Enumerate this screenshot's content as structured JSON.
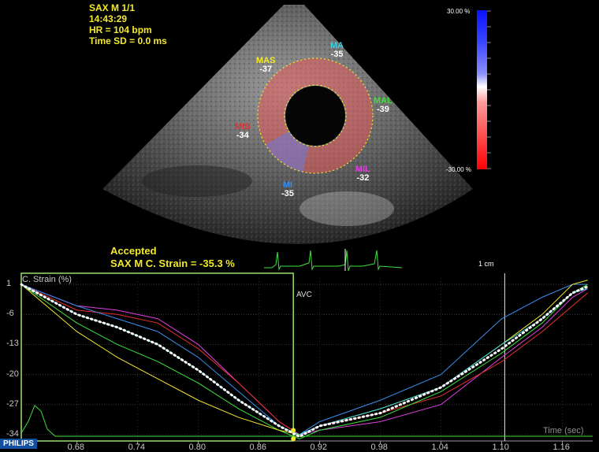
{
  "header": {
    "view": "SAX M  1/1",
    "time": "14:43:29",
    "hr": "HR = 104 bpm",
    "timesd": "Time SD = 0.0 ms"
  },
  "segments": [
    {
      "key": "MA",
      "label": "MA",
      "value": "-35",
      "color": "#3ad0e0"
    },
    {
      "key": "MAS",
      "label": "MAS",
      "value": "-37",
      "color": "#f2e92b"
    },
    {
      "key": "MAL",
      "label": "MAL",
      "value": "-39",
      "color": "#3ee03e"
    },
    {
      "key": "MIS",
      "label": "MIS",
      "value": "-34",
      "color": "#e83030"
    },
    {
      "key": "MIL",
      "label": "MIL",
      "value": "-32",
      "color": "#e040e0"
    },
    {
      "key": "MI",
      "label": "MI",
      "value": "-35",
      "color": "#3a8ef0"
    }
  ],
  "colorscale": {
    "top": "30.00 %",
    "bottom": "-30.00 %"
  },
  "status": {
    "accepted": "Accepted",
    "result": "SAX M C. Strain = -35.3 %"
  },
  "scale_mark": "1 cm",
  "chart_data": {
    "type": "line",
    "ylabel": "C. Strain (%)",
    "xlabel": "Time (sec)",
    "marker": "AVC",
    "yticks": [
      1,
      -6,
      -13,
      -20,
      -27,
      -34
    ],
    "xticks": [
      "0.68",
      "0.74",
      "0.80",
      "0.86",
      "0.92",
      "0.98",
      "1.04",
      "1.10",
      "1.16"
    ],
    "xlim": [
      0.625,
      1.19
    ],
    "ylim": [
      -35.5,
      2.5
    ],
    "avc_x": 0.894,
    "series": [
      {
        "color": "#e040e0",
        "points": [
          [
            0.625,
            1
          ],
          [
            0.68,
            -4
          ],
          [
            0.72,
            -5
          ],
          [
            0.76,
            -7
          ],
          [
            0.8,
            -13
          ],
          [
            0.84,
            -22
          ],
          [
            0.88,
            -31
          ],
          [
            0.9,
            -34
          ],
          [
            0.92,
            -33
          ],
          [
            0.98,
            -31
          ],
          [
            1.04,
            -27
          ],
          [
            1.1,
            -16
          ],
          [
            1.14,
            -9
          ],
          [
            1.17,
            -2
          ],
          [
            1.185,
            0
          ]
        ]
      },
      {
        "color": "#e83030",
        "points": [
          [
            0.625,
            1
          ],
          [
            0.68,
            -5
          ],
          [
            0.72,
            -6
          ],
          [
            0.76,
            -8
          ],
          [
            0.8,
            -14
          ],
          [
            0.84,
            -22
          ],
          [
            0.88,
            -31
          ],
          [
            0.9,
            -34
          ],
          [
            0.92,
            -32
          ],
          [
            0.98,
            -29
          ],
          [
            1.04,
            -25
          ],
          [
            1.1,
            -17
          ],
          [
            1.14,
            -10
          ],
          [
            1.17,
            -4
          ],
          [
            1.185,
            -1
          ]
        ]
      },
      {
        "color": "#3a8ef0",
        "points": [
          [
            0.625,
            1
          ],
          [
            0.68,
            -4
          ],
          [
            0.72,
            -7
          ],
          [
            0.76,
            -10
          ],
          [
            0.8,
            -16
          ],
          [
            0.84,
            -24
          ],
          [
            0.88,
            -32
          ],
          [
            0.9,
            -34
          ],
          [
            0.92,
            -31
          ],
          [
            0.98,
            -26
          ],
          [
            1.04,
            -20
          ],
          [
            1.1,
            -7
          ],
          [
            1.14,
            -2
          ],
          [
            1.17,
            1
          ],
          [
            1.185,
            1
          ]
        ]
      },
      {
        "color": "#3ee03e",
        "points": [
          [
            0.625,
            1
          ],
          [
            0.68,
            -8
          ],
          [
            0.72,
            -13
          ],
          [
            0.76,
            -17
          ],
          [
            0.8,
            -22
          ],
          [
            0.84,
            -28
          ],
          [
            0.88,
            -33
          ],
          [
            0.9,
            -35
          ],
          [
            0.92,
            -33
          ],
          [
            0.98,
            -30
          ],
          [
            1.04,
            -24
          ],
          [
            1.1,
            -15
          ],
          [
            1.14,
            -8
          ],
          [
            1.17,
            -1
          ],
          [
            1.185,
            1
          ]
        ]
      },
      {
        "color": "#f2e92b",
        "points": [
          [
            0.625,
            1
          ],
          [
            0.68,
            -10
          ],
          [
            0.72,
            -16
          ],
          [
            0.76,
            -21
          ],
          [
            0.8,
            -26
          ],
          [
            0.84,
            -30
          ],
          [
            0.88,
            -33
          ],
          [
            0.9,
            -34
          ],
          [
            0.92,
            -32
          ],
          [
            0.98,
            -28
          ],
          [
            1.04,
            -23
          ],
          [
            1.1,
            -13
          ],
          [
            1.14,
            -6
          ],
          [
            1.17,
            1
          ],
          [
            1.185,
            2
          ]
        ]
      },
      {
        "color": "#3ad0e0",
        "points": [
          [
            0.625,
            1
          ],
          [
            0.68,
            -6
          ],
          [
            0.72,
            -9
          ],
          [
            0.76,
            -13
          ],
          [
            0.8,
            -19
          ],
          [
            0.84,
            -26
          ],
          [
            0.88,
            -32
          ],
          [
            0.9,
            -34
          ],
          [
            0.92,
            -32
          ],
          [
            0.98,
            -28
          ],
          [
            1.04,
            -23
          ],
          [
            1.1,
            -13
          ],
          [
            1.14,
            -7
          ],
          [
            1.17,
            -1
          ],
          [
            1.185,
            0
          ]
        ]
      }
    ],
    "average": [
      [
        0.625,
        1
      ],
      [
        0.68,
        -6
      ],
      [
        0.72,
        -9
      ],
      [
        0.76,
        -13
      ],
      [
        0.8,
        -19
      ],
      [
        0.84,
        -26
      ],
      [
        0.88,
        -32
      ],
      [
        0.9,
        -34.5
      ],
      [
        0.92,
        -32
      ],
      [
        0.98,
        -29
      ],
      [
        1.04,
        -23
      ],
      [
        1.1,
        -14
      ],
      [
        1.14,
        -7
      ],
      [
        1.17,
        -1
      ],
      [
        1.185,
        0.5
      ]
    ]
  }
}
